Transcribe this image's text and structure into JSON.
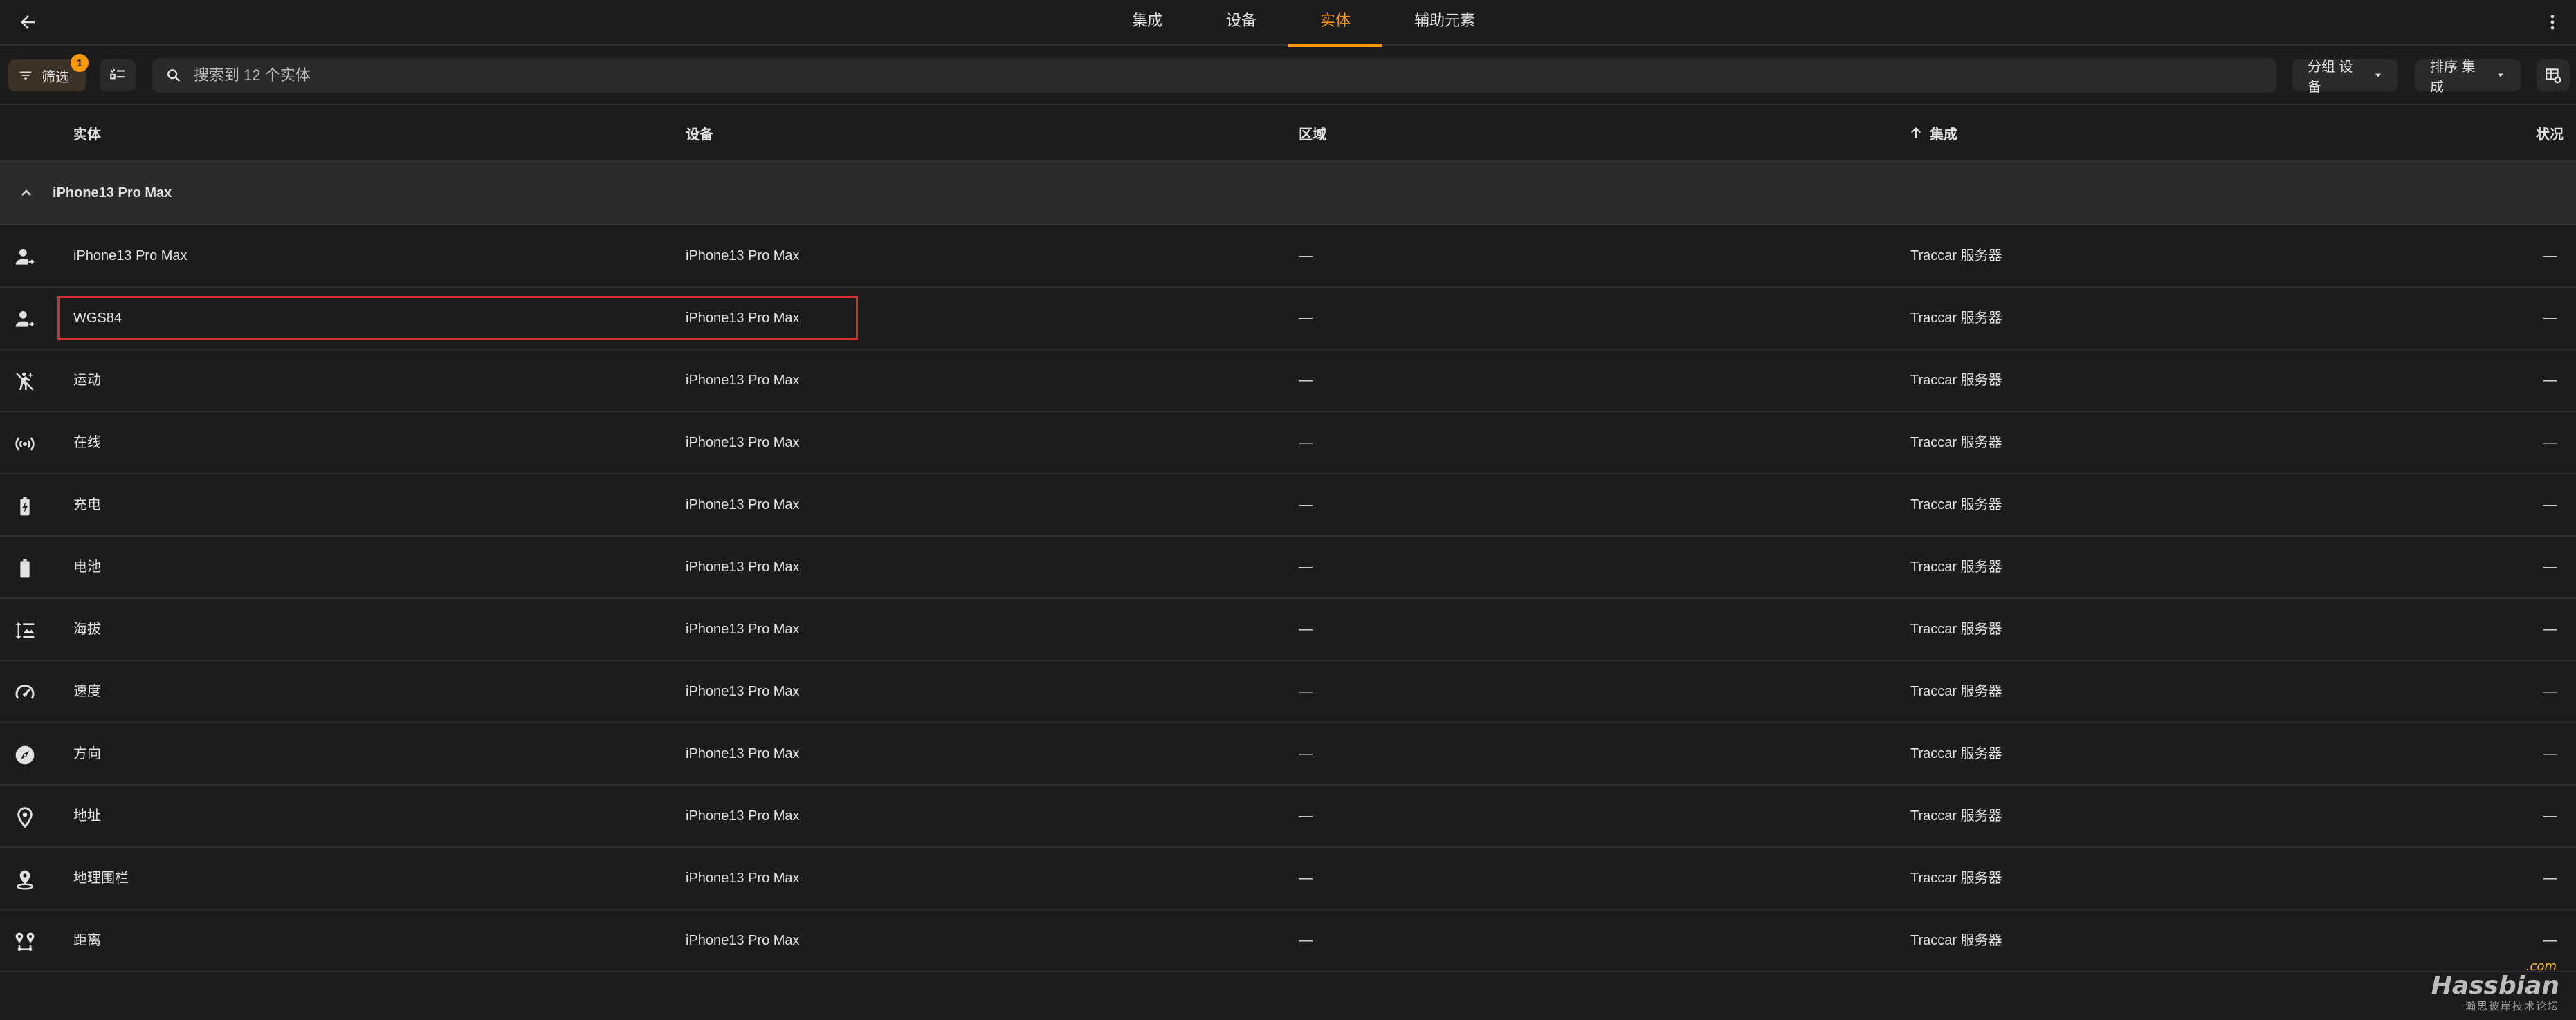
{
  "topbar": {
    "tabs": [
      {
        "label": "集成",
        "active": false
      },
      {
        "label": "设备",
        "active": false
      },
      {
        "label": "实体",
        "active": true
      },
      {
        "label": "辅助元素",
        "active": false
      }
    ]
  },
  "toolbar": {
    "filter_label": "筛选",
    "filter_badge": "1",
    "search_placeholder": "搜索到 12 个实体",
    "group_label": "分组 设备",
    "sort_label": "排序 集成"
  },
  "table": {
    "headers": {
      "name": "实体",
      "device": "设备",
      "area": "区域",
      "integration": "集成",
      "status": "状况"
    },
    "group": {
      "label": "iPhone13 Pro Max"
    },
    "rows": [
      {
        "icon": "account-arrow-icon",
        "name": "iPhone13 Pro Max",
        "device": "iPhone13 Pro Max",
        "area": "—",
        "integration": "Traccar 服务器",
        "status": "—"
      },
      {
        "icon": "account-arrow-icon",
        "name": "WGS84",
        "device": "iPhone13 Pro Max",
        "area": "—",
        "integration": "Traccar 服务器",
        "status": "—"
      },
      {
        "icon": "motion-off-icon",
        "name": "运动",
        "device": "iPhone13 Pro Max",
        "area": "—",
        "integration": "Traccar 服务器",
        "status": "—"
      },
      {
        "icon": "broadcast-icon",
        "name": "在线",
        "device": "iPhone13 Pro Max",
        "area": "—",
        "integration": "Traccar 服务器",
        "status": "—"
      },
      {
        "icon": "battery-charging-icon",
        "name": "充电",
        "device": "iPhone13 Pro Max",
        "area": "—",
        "integration": "Traccar 服务器",
        "status": "—"
      },
      {
        "icon": "battery-icon",
        "name": "电池",
        "device": "iPhone13 Pro Max",
        "area": "—",
        "integration": "Traccar 服务器",
        "status": "—"
      },
      {
        "icon": "altitude-icon",
        "name": "海拔",
        "device": "iPhone13 Pro Max",
        "area": "—",
        "integration": "Traccar 服务器",
        "status": "—"
      },
      {
        "icon": "speedometer-icon",
        "name": "速度",
        "device": "iPhone13 Pro Max",
        "area": "—",
        "integration": "Traccar 服务器",
        "status": "—"
      },
      {
        "icon": "compass-icon",
        "name": "方向",
        "device": "iPhone13 Pro Max",
        "area": "—",
        "integration": "Traccar 服务器",
        "status": "—"
      },
      {
        "icon": "map-marker-icon",
        "name": "地址",
        "device": "iPhone13 Pro Max",
        "area": "—",
        "integration": "Traccar 服务器",
        "status": "—"
      },
      {
        "icon": "map-marker-radius-icon",
        "name": "地理围栏",
        "device": "iPhone13 Pro Max",
        "area": "—",
        "integration": "Traccar 服务器",
        "status": "—"
      },
      {
        "icon": "map-marker-distance-icon",
        "name": "距离",
        "device": "iPhone13 Pro Max",
        "area": "—",
        "integration": "Traccar 服务器",
        "status": "—"
      }
    ]
  },
  "watermark": {
    "logo": "Hassbian",
    "com": ".com",
    "sub": "瀚思彼岸技术论坛"
  },
  "colors": {
    "background": "#1c1c1c",
    "accent": "#ff9800",
    "highlight": "#d32f2f"
  }
}
